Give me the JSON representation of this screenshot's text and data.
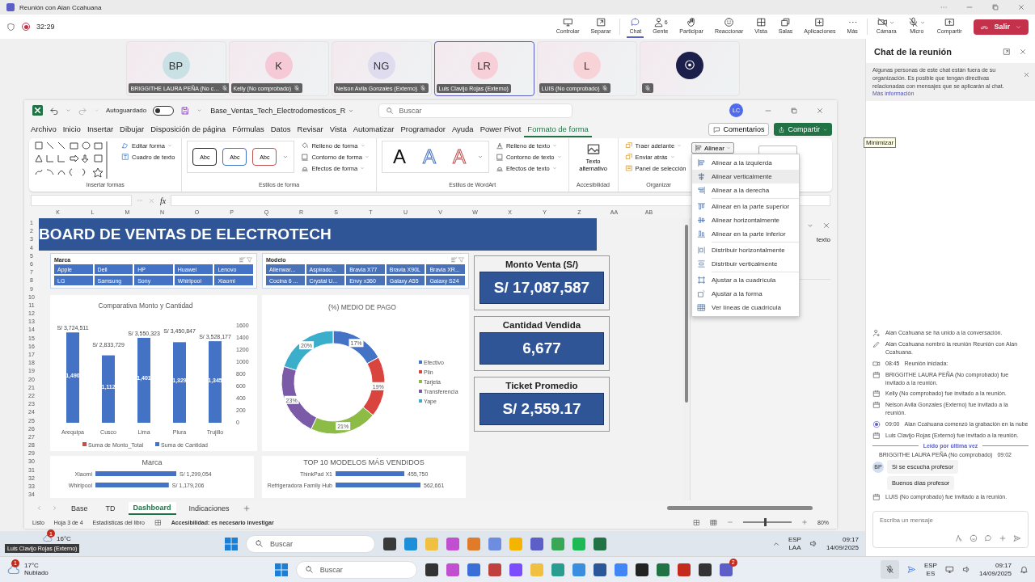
{
  "window": {
    "title": "Reunión con Alan Ccahuana"
  },
  "meeting_bar": {
    "timer": "32:29",
    "recording": true,
    "tools": [
      {
        "label": "Controlar",
        "selected": false
      },
      {
        "label": "Separar",
        "selected": false
      },
      {
        "label": "Chat",
        "selected": true
      },
      {
        "label": "Gente",
        "badge": "6",
        "selected": false
      },
      {
        "label": "Participar",
        "selected": false
      },
      {
        "label": "Reaccionar",
        "selected": false
      },
      {
        "label": "Vista",
        "selected": false
      },
      {
        "label": "Salas",
        "selected": false
      },
      {
        "label": "Aplicaciones",
        "selected": false
      },
      {
        "label": "Más",
        "selected": false
      },
      {
        "label": "Cámara",
        "caret": true,
        "selected": false
      },
      {
        "label": "Micro",
        "caret": true,
        "selected": false
      },
      {
        "label": "Compartir",
        "selected": false
      }
    ],
    "leave_button": "Salir"
  },
  "participants": [
    {
      "kind": "avatar",
      "initials": "BP",
      "name": "BRIGGITHE LAURA PEÑA (No c…",
      "muted": true,
      "selected": false,
      "color": "#c9e1e4"
    },
    {
      "kind": "avatar",
      "initials": "K",
      "name": "Kelly (No comprobado)",
      "muted": true,
      "selected": false,
      "color": "#f5c9d6"
    },
    {
      "kind": "avatar",
      "initials": "NG",
      "name": "Nelson Avila Gonzales (Externo)",
      "muted": true,
      "selected": false,
      "color": "#e0dcef"
    },
    {
      "kind": "avatar",
      "initials": "LR",
      "name": "Luis Clavijo Rojas (Externo)",
      "muted": false,
      "selected": true,
      "color": "#f7cfd8"
    },
    {
      "kind": "avatar",
      "initials": "L",
      "name": "LUIS (No comprobado)",
      "muted": true,
      "selected": false,
      "color": "#f7d3d8"
    },
    {
      "kind": "logo",
      "muted": true,
      "selected": false
    }
  ],
  "excel": {
    "file_name": "Base_Ventas_Tech_Electrodomesticos_R",
    "autosave": {
      "label": "Autoguardado",
      "on": false
    },
    "search_placeholder": "Buscar",
    "user_initials": "LC",
    "menu_tabs": [
      {
        "label": "Archivo",
        "selected": false
      },
      {
        "label": "Inicio",
        "selected": false
      },
      {
        "label": "Insertar",
        "selected": false
      },
      {
        "label": "Dibujar",
        "selected": false
      },
      {
        "label": "Disposición de página",
        "selected": false
      },
      {
        "label": "Fórmulas",
        "selected": false
      },
      {
        "label": "Datos",
        "selected": false
      },
      {
        "label": "Revisar",
        "selected": false
      },
      {
        "label": "Vista",
        "selected": false
      },
      {
        "label": "Automatizar",
        "selected": false
      },
      {
        "label": "Programador",
        "selected": false
      },
      {
        "label": "Ayuda",
        "selected": false
      },
      {
        "label": "Power Pivot",
        "selected": false
      },
      {
        "label": "Formato de forma",
        "selected": true
      }
    ],
    "comments_button": "Comentarios",
    "share_button": "Compartir",
    "ribbon": [
      {
        "kind": "shapes",
        "title": "Insertar formas",
        "commands": [
          "Editar forma",
          "Cuadro de texto"
        ]
      },
      {
        "kind": "styles",
        "title": "Estilos de forma",
        "samples": [
          "Abc",
          "Abc",
          "Abc"
        ],
        "commands": [
          "Relleno de forma",
          "Contorno de forma",
          "Efectos de forma"
        ]
      },
      {
        "kind": "wordart",
        "title": "Estilos de WordArt",
        "samples": [
          "A",
          "A",
          "A"
        ],
        "commands": [
          "Relleno de texto",
          "Contorno de texto",
          "Efectos de texto"
        ]
      },
      {
        "kind": "big",
        "title": "Accesibilidad",
        "commands": [
          "Texto alternativo"
        ]
      },
      {
        "kind": "arrange",
        "title": "Organizar",
        "commands": [
          "Traer adelante",
          "Enviar atrás",
          "Panel de selección"
        ]
      }
    ],
    "align_menu": {
      "button": "Alinear",
      "items": [
        {
          "label": "Alinear a la izquierda",
          "highlighted": false
        },
        {
          "label": "Alinear verticalmente",
          "highlighted": true
        },
        {
          "label": "Alinear a la derecha",
          "highlighted": false,
          "divider_after": true
        },
        {
          "label": "Alinear en la parte superior",
          "highlighted": false
        },
        {
          "label": "Alinear horizontalmente",
          "highlighted": false
        },
        {
          "label": "Alinear en la parte inferior",
          "highlighted": false,
          "divider_after": true
        },
        {
          "label": "Distribuir horizontalmente",
          "highlighted": false
        },
        {
          "label": "Distribuir verticalmente",
          "highlighted": false,
          "divider_after": true
        },
        {
          "label": "Ajustar a la cuadrícula",
          "highlighted": false
        },
        {
          "label": "Ajustar a la forma",
          "highlighted": false
        },
        {
          "label": "Ver líneas de cuadrícula",
          "highlighted": false
        }
      ]
    },
    "function_label": "fx",
    "columns": [
      "K",
      "L",
      "M",
      "N",
      "O",
      "P",
      "Q",
      "R",
      "S",
      "T",
      "U",
      "V",
      "W",
      "X",
      "Y",
      "Z",
      "AA",
      "AB"
    ],
    "rows": [
      "1",
      "2",
      "3",
      "4",
      "5",
      "6",
      "7",
      "8",
      "9",
      "10",
      "11",
      "12",
      "13",
      "14",
      "15",
      "16",
      "17",
      "18",
      "19",
      "20",
      "21",
      "22",
      "23",
      "24",
      "25",
      "26",
      "27",
      "28",
      "29",
      "30",
      "31",
      "32",
      "33",
      "34"
    ],
    "side_pane": {
      "text": "texto"
    },
    "dashboard": {
      "banner": "BOARD DE VENTAS DE ELECTROTECH",
      "slicers": [
        {
          "title": "Marca",
          "items": [
            "Apple",
            "Dell",
            "HP",
            "Huawei",
            "Lenovo",
            "LG",
            "Samsung",
            "Sony",
            "Whirlpool",
            "Xiaomi"
          ]
        },
        {
          "title": "Modelo",
          "items": [
            "Alienwar...",
            "Aspirado...",
            "Bravia X77",
            "Bravia X90L",
            "Bravia XR...",
            "Cocina 6 ...",
            "Crystal U...",
            "Envy x360",
            "Galaxy A55",
            "Galaxy S24"
          ]
        }
      ],
      "charts": [
        {
          "chart_data": {
            "type": "bar",
            "title": "Comparativa Monto y Cantidad",
            "categories": [
              "Arequipa",
              "Cusco",
              "Lima",
              "Piura",
              "Trujillo"
            ],
            "series": [
              {
                "name": "Suma de Monto_Total",
                "color": "#c0504d",
                "values": [
                  null,
                  null,
                  null,
                  null,
                  null
                ]
              },
              {
                "name": "Suma de Cantidad",
                "color": "#4472c4",
                "values": [
                  1490,
                  1112,
                  1401,
                  1329,
                  1345
                ]
              }
            ],
            "ylim": [
              0,
              1600
            ],
            "yticks": [
              0,
              200,
              400,
              600,
              800,
              1000,
              1200,
              1400,
              1600
            ],
            "value_labels": [
              "1,490",
              "1,112",
              "1,401",
              "1,329",
              "1,345"
            ],
            "legend": "bottom",
            "annotations": [
              "S/ 3,724,511",
              "S/ 2,833,729",
              "S/ 3,550,323",
              "S/ 3,450,847",
              "S/ 3,528,177"
            ]
          }
        },
        {
          "chart_data": {
            "type": "donut",
            "title": "(%) MEDIO DE PAGO",
            "categories": [
              "Efectivo",
              "Plin",
              "Tarjeta",
              "Transferencia",
              "Yape"
            ],
            "values": [
              17,
              19,
              21,
              23,
              20
            ],
            "colors": [
              "#4472c4",
              "#d9443f",
              "#8cbc46",
              "#7b5ba8",
              "#3aaecb"
            ],
            "legend": "right",
            "value_labels": [
              "17%",
              "19%",
              "21%",
              "23%",
              "20%"
            ]
          }
        }
      ],
      "bottom_charts": [
        {
          "chart_data": {
            "type": "bar",
            "orientation": "horizontal",
            "title": "Marca",
            "categories": [
              "Xiaomi",
              "Whirlpool"
            ],
            "values": [
              1299054,
              1179206
            ],
            "value_labels": [
              "S/ 1,299,054",
              "S/ 1,179,206"
            ]
          }
        },
        {
          "chart_data": {
            "type": "bar",
            "orientation": "horizontal",
            "title": "TOP 10 MODELOS MÁS VENDIDOS",
            "categories": [
              "ThinkPad X1",
              "Refrigeradora Family Hub"
            ],
            "values": [
              455750,
              562661
            ],
            "value_labels": [
              "455,750",
              "562,661"
            ]
          }
        }
      ],
      "kpis": [
        {
          "title": "Monto Venta (S/)",
          "value": "S/ 17,087,587"
        },
        {
          "title": "Cantidad Vendida",
          "value": "6,677"
        },
        {
          "title": "Ticket Promedio",
          "value": "S/ 2,559.17"
        }
      ]
    },
    "sheet_tabs": [
      {
        "label": "Base",
        "selected": false
      },
      {
        "label": "TD",
        "selected": false
      },
      {
        "label": "Dashboard",
        "selected": true
      },
      {
        "label": "Indicaciones",
        "selected": false
      }
    ],
    "status_bar": {
      "ready": "Listo",
      "sheet": "Hoja 3 de 4",
      "stats": "Estadísticas del libro",
      "accessibility": "Accesibilidad: es necesario investigar",
      "zoom": {
        "level": 0.45,
        "reading": "80%"
      }
    }
  },
  "shared_taskbar": {
    "badge": "1",
    "weather": "16°C",
    "search_placeholder": "Buscar",
    "language": "ESP",
    "region": "LAA",
    "time": "09:17",
    "date": "14/09/2025"
  },
  "tooltips": [
    {
      "kind": "chat",
      "text": "Minimizar"
    },
    {
      "kind": "stage",
      "text": "Luis Clavijo Rojas (Externo)"
    }
  ],
  "chat": {
    "title": "Chat de la reunión",
    "notice": "Algunas personas de este chat están fuera de su organización. Es posible que tengan directivas relacionadas con mensajes que se aplicarán al chat.",
    "notice_link": "Más información",
    "events": [
      {
        "kind": "join",
        "text": "Alan Ccahuana se ha unido a la conversación."
      },
      {
        "kind": "rename",
        "text": "Alan Ccahuana nombró la reunión Reunión con Alan Ccahuana."
      },
      {
        "kind": "meeting",
        "time": "08:45",
        "text": "Reunión iniciada:"
      },
      {
        "kind": "invite",
        "text": "BRIGGITHE LAURA PEÑA (No comprobado) fue invitado a la reunión."
      },
      {
        "kind": "invite",
        "text": "Kelly (No comprobado) fue invitado a la reunión."
      },
      {
        "kind": "invite",
        "text": "Nelson Avila Gonzales (Externo) fue invitado a la reunión."
      },
      {
        "kind": "record",
        "time": "09:00",
        "text": "Alan Ccahuana comenzó la grabación en la nube"
      },
      {
        "kind": "invite",
        "text": "Luis Clavijo Rojas (Externo) fue invitado a la reunión."
      },
      {
        "kind": "divider",
        "text": "Leído por última vez"
      },
      {
        "kind": "message",
        "author": "BRIGGITHE LAURA PEÑA (No comprobado)",
        "time": "09:02",
        "initials": "BP",
        "bubbles": [
          "Si se escucha profesor",
          "Buenos días profesor"
        ]
      },
      {
        "kind": "invite",
        "text": "LUIS (No comprobado) fue invitado a la reunión."
      }
    ],
    "compose_placeholder": "Escriba un mensaje"
  },
  "taskbar": {
    "badge": "1",
    "weather_temp": "17°C",
    "weather_text": "Nublado",
    "search_placeholder": "Buscar",
    "language": "ESP",
    "region": "ES",
    "time": "09:17",
    "date": "14/09/2025",
    "app_badge": "2"
  }
}
